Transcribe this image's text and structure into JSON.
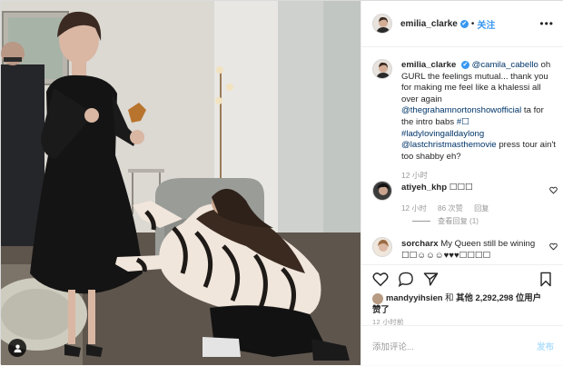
{
  "header": {
    "username": "emilia_clarke",
    "verified_mark": "✔",
    "separator": "•",
    "follow_label": "关注",
    "more_label": "•••"
  },
  "caption": {
    "username": "emilia_clarke",
    "mention_1": "@camila_cabello",
    "text_1": " oh GURL the feelings mutual... thank you for making me feel like a khalessi all over again ",
    "mention_2": "@thegrahamnortonshowofficial",
    "text_2": " ta for the intro babs ",
    "hashtag_1": "#☐",
    "hashtag_2": "#ladylovingalldaylong",
    "mention_3": "@lastchristmasthemovie",
    "text_3": " press tour ain't too shabby eh?",
    "time": "12 小时"
  },
  "comments": [
    {
      "username": "atiyeh_khp",
      "text": "☐☐☐",
      "time": "12 小时",
      "likes": "86 次赞",
      "reply_label": "回复",
      "view_replies": "查看回复 (1)"
    },
    {
      "username": "sorcharx",
      "text": "My Queen still be wining ☐☐☺☺☺♥♥♥☐☐☐☐"
    }
  ],
  "engagement": {
    "liker": "mandyyihsien",
    "and_label": "和",
    "others_label": "其他",
    "count": "2,292,298",
    "suffix_label": "位用户",
    "liked_label": "赞了",
    "time_ago": "12 小时前"
  },
  "add_comment": {
    "placeholder": "添加评论...",
    "post_label": "发布"
  },
  "icons": {
    "tag": "person-tag-icon",
    "like": "heart-icon",
    "comment": "comment-bubble-icon",
    "share": "paper-plane-icon",
    "save": "bookmark-icon",
    "more": "more-dots-icon"
  },
  "colors": {
    "link": "#003569",
    "accent": "#3897f0",
    "post_disabled": "#b2dffc",
    "muted": "#999999"
  }
}
